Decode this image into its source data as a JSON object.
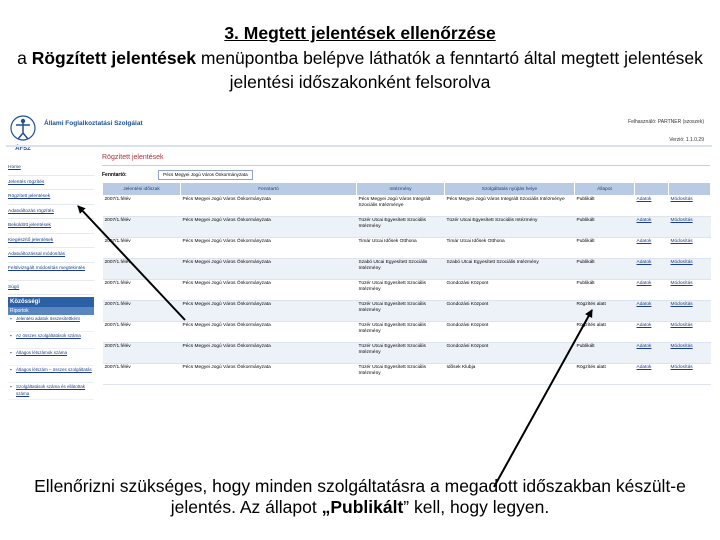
{
  "slide": {
    "title": "3. Megtett jelentések ellenőrzése",
    "subtitle_prefix": "a ",
    "subtitle_bold": "Rögzített jelentések",
    "subtitle_rest": " menüpontba belépve láthatók a fenntartó által megtett jelentések jelentési időszakonként felsorolva",
    "note_text": "Ellenőrizni szükséges, hogy minden szolgáltatásra a megadott időszakban készült-e jelentés. Az állapot ",
    "note_bold": "„Publikált",
    "note_end": "” kell, hogy legyen."
  },
  "app": {
    "logo_text": "ÁFSZ",
    "agency_name": "Állami Foglalkoztatási Szolgálat",
    "user_info": "Felhasználó: PARTNER (szoszek)",
    "version": "Verzió: 1.1.0.29"
  },
  "sidebar": {
    "links": [
      {
        "label": "Home",
        "multi": false
      },
      {
        "label": "Jelentés rögzítés",
        "multi": false
      },
      {
        "label": "Rögzített jelentések",
        "multi": false
      },
      {
        "label": "Adatváltozás rögzítés",
        "multi": false
      },
      {
        "label": "Beküldött jelentések",
        "multi": false
      },
      {
        "label": "Kiegészítő jelentések",
        "multi": false
      },
      {
        "label": "Adatváltozással módosítás",
        "multi": false
      },
      {
        "label": "Felülvizsgált módosítás megtekintés",
        "multi": true
      },
      {
        "label": "Súgó",
        "multi": false
      }
    ],
    "section_title": "Közösségi",
    "section_sub": "Riportok",
    "reports": [
      "Jelentési adatok összesítettként",
      "Az összes szolgáltatások száma",
      "Átlagos létszámok száma",
      "Átlagos létszám – összes szolgáltatás",
      "Szolgáltatások száma és ellátottak száma"
    ]
  },
  "main": {
    "page_title": "Rögzített jelentések",
    "filter_label": "Fenntartó:",
    "filter_value": "Pécs Megyei Jogú Város Önkormányzata",
    "columns": [
      "Jelentési időszak",
      "Fenntartó",
      "Intézmény",
      "Szolgáltatás nyújtás helye",
      "Állapot",
      "",
      ""
    ],
    "rows": [
      [
        "2007/1.félév",
        "Pécs Megyei Jogú Város Önkormányzata",
        "Pécs Megyei Jogú Város Integrált Szociális Intézménye",
        "Pécs Megyei Jogú Város Integrált Szociális Intézménye",
        "Publikált",
        "Adatok",
        "Módosítás"
      ],
      [
        "2007/1.félév",
        "Pécs Megyei Jogú Város Önkormányzata",
        "Tüzér Utcai Egyesített Szociális Intézmény",
        "Tüzér Utcai Egyesített Szociális Intézmény",
        "Publikált",
        "Adatok",
        "Módosítás"
      ],
      [
        "2007/1.félév",
        "Pécs Megyei Jogú Város Önkormányzata",
        "Timár Utcai Idősek Otthona",
        "Timár Utcai Idősek Otthona",
        "Publikált",
        "Adatok",
        "Módosítás"
      ],
      [
        "2007/1.félév",
        "Pécs Megyei Jogú Város Önkormányzata",
        "Szabó Utcai Egyesített Szociális Intézmény",
        "Szabó Utcai Egyesített Szociális Intézmény",
        "Publikált",
        "Adatok",
        "Módosítás"
      ],
      [
        "2007/1.félév",
        "Pécs Megyei Jogú Város Önkormányzata",
        "Tüzér Utcai Egyesített Szociális Intézmény",
        "Gondozási Központ",
        "Publikált",
        "Adatok",
        "Módosítás"
      ],
      [
        "2007/1.félév",
        "Pécs Megyei Jogú Város Önkormányzata",
        "Tüzér Utcai Egyesített Szociális Intézmény",
        "Gondozási Központ",
        "Rögzítés alatt",
        "Adatok",
        "Módosítás"
      ],
      [
        "2007/1.félév",
        "Pécs Megyei Jogú Város Önkormányzata",
        "Tüzér Utcai Egyesített Szociális Intézmény",
        "Gondozási Központ",
        "Rögzítés alatt",
        "Adatok",
        "Módosítás"
      ],
      [
        "2007/1.félév",
        "Pécs Megyei Jogú Város Önkormányzata",
        "Tüzér Utcai Egyesített Szociális Intézmény",
        "Gondozási Központ",
        "Publikált",
        "Adatok",
        "Módosítás"
      ],
      [
        "2007/1.félév",
        "Pécs Megyei Jogú Város Önkormányzata",
        "Tüzér Utcai Egyesített Szociális Intézmény",
        "Idősek Klubja",
        "Rögzítés alatt",
        "Adatok",
        "Módosítás"
      ]
    ]
  },
  "colors": {
    "arrow": "#000000",
    "header_blue": "#2b5fa6",
    "table_header": "#b9cbe4",
    "page_title_red": "#b0303a"
  }
}
